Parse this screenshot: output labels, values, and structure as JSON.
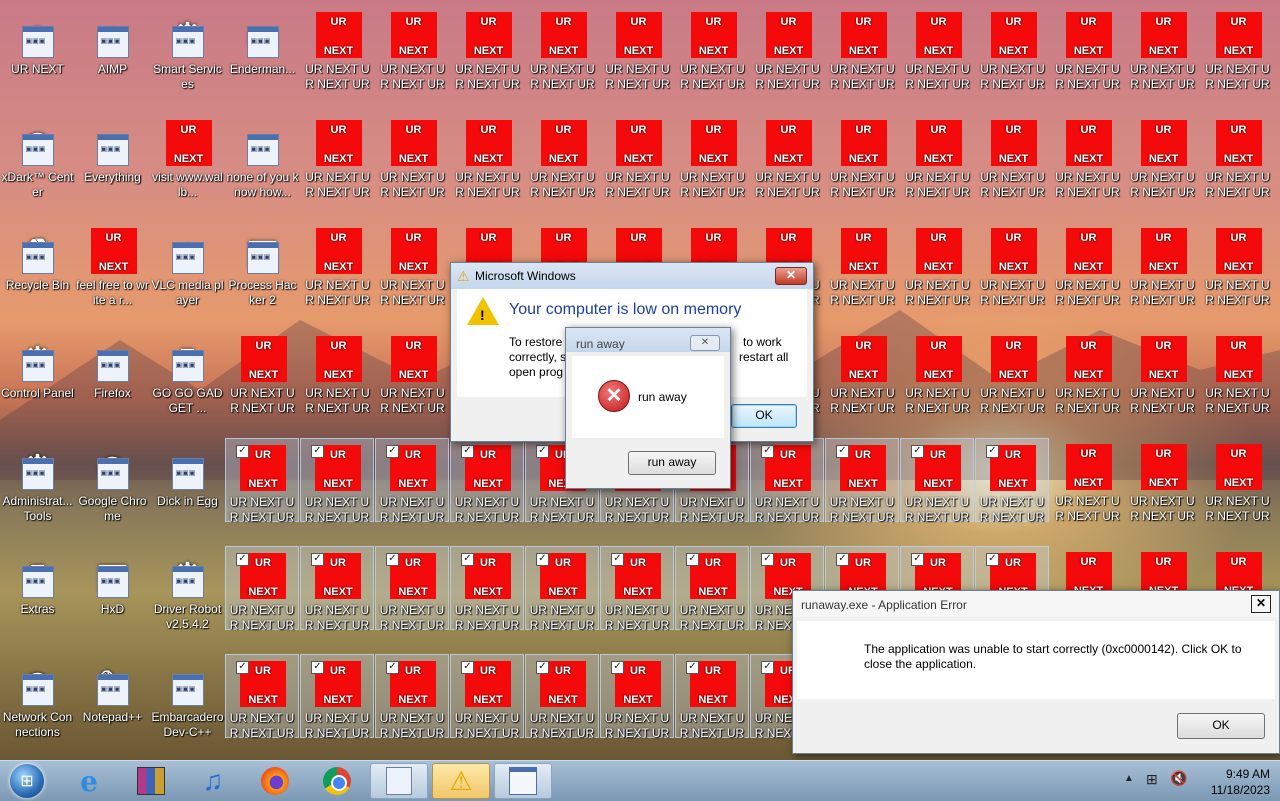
{
  "desktop": {
    "named_icons": [
      {
        "label": "UR NEXT",
        "icon": "anime-girl-icon"
      },
      {
        "label": "AIMP",
        "icon": "aimp-icon"
      },
      {
        "label": "Smart Services",
        "icon": "gears-icon"
      },
      {
        "label": "Enderman...",
        "icon": "window-icon"
      },
      {
        "label": "xDark™ Center",
        "icon": "xdark-icon"
      },
      {
        "label": "Everything",
        "icon": "everything-icon"
      },
      {
        "label": "visit www.wallb...",
        "icon": "ur-next-tile-icon"
      },
      {
        "label": "none of you know how...",
        "icon": "circle-logo-icon"
      },
      {
        "label": "Recycle Bin",
        "icon": "recycle-bin-icon"
      },
      {
        "label": "feel free to write a r...",
        "icon": "ur-next-tile-icon"
      },
      {
        "label": "VLC media player",
        "icon": "vlc-cone-icon"
      },
      {
        "label": "Process Hacker 2",
        "icon": "process-hacker-icon"
      },
      {
        "label": "Control Panel",
        "icon": "control-panel-icon"
      },
      {
        "label": "Firefox",
        "icon": "firefox-icon"
      },
      {
        "label": "GO GO GADGET ...",
        "icon": "gadget-icon"
      },
      {
        "label": "Administrat... Tools",
        "icon": "admin-tools-icon"
      },
      {
        "label": "Google Chrome",
        "icon": "chrome-icon"
      },
      {
        "label": "Dick in Egg",
        "icon": "egg-icon"
      },
      {
        "label": "Extras",
        "icon": "extras-icon"
      },
      {
        "label": "HxD",
        "icon": "hxd-icon"
      },
      {
        "label": "Driver Robot v2.5.4.2",
        "icon": "driver-robot-icon"
      },
      {
        "label": "Network Connections",
        "icon": "network-icon"
      },
      {
        "label": "Notepad++",
        "icon": "notepad-icon"
      },
      {
        "label": "Embarcadero Dev-C++",
        "icon": "devcpp-icon"
      }
    ],
    "tile_label": "UR NEXT UR NEXT UR ...",
    "tile_top_text": "UR",
    "tile_bottom_text": "NEXT"
  },
  "dialogs": {
    "low_memory": {
      "title": "Microsoft Windows",
      "heading": "Your computer is low on memory",
      "body_line1_left": "To restore",
      "body_line1_right": "to work",
      "body_line2_left": "correctly, s",
      "body_line2_right": "restart all",
      "body_line3_left": "open prog",
      "ok_label": "OK",
      "accent": "#1e3fa0"
    },
    "run_away": {
      "title": "run away",
      "message": "run away",
      "button_label": "run away"
    },
    "app_error": {
      "title": "runaway.exe - Application Error",
      "message": "The application was unable to start correctly (0xc0000142). Click OK to close the application.",
      "ok_label": "OK"
    }
  },
  "taskbar": {
    "time": "9:49 AM",
    "date": "11/18/2023",
    "pinned": [
      "start-orb",
      "internet-explorer",
      "archive-manager",
      "music-player",
      "firefox",
      "chrome",
      "program-window",
      "warning-window",
      "document-window"
    ]
  },
  "colors": {
    "tile_red": "#f40a0a",
    "taskbar": "#8fabc6"
  }
}
